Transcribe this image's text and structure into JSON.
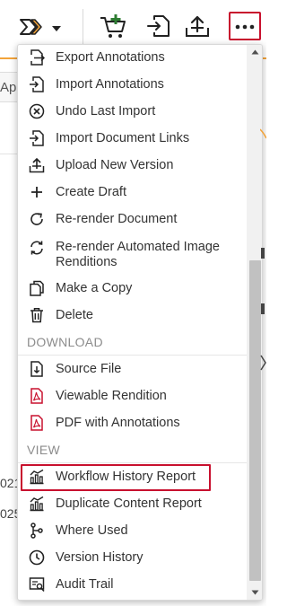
{
  "toolbar": {
    "buttons": [
      {
        "name": "workflow-dropdown",
        "icon": "workflow-chevron-icon"
      },
      {
        "name": "add-to-cart-button",
        "icon": "cart-plus-icon"
      },
      {
        "name": "import-button",
        "icon": "import-icon"
      },
      {
        "name": "upload-button",
        "icon": "upload-icon"
      },
      {
        "name": "more-actions-button",
        "icon": "ellipsis-icon"
      }
    ]
  },
  "background": {
    "tab_fragment": "Ap",
    "row_fragment_1": "021",
    "row_fragment_2": "025"
  },
  "menu": {
    "items_top": [
      {
        "label": "Export Annotations",
        "icon": "export-icon"
      },
      {
        "label": "Import Annotations",
        "icon": "import-icon"
      },
      {
        "label": "Undo Last Import",
        "icon": "circle-x-icon"
      },
      {
        "label": "Import Document Links",
        "icon": "import-icon"
      },
      {
        "label": "Upload New Version",
        "icon": "upload-icon"
      },
      {
        "label": "Create Draft",
        "icon": "plus-icon"
      },
      {
        "label": "Re-render Document",
        "icon": "refresh-icon"
      },
      {
        "label": "Re-render Automated Image Renditions",
        "icon": "sync-icon"
      },
      {
        "label": "Make a Copy",
        "icon": "copy-icon"
      },
      {
        "label": "Delete",
        "icon": "trash-icon"
      }
    ],
    "download_header": "DOWNLOAD",
    "items_download": [
      {
        "label": "Source File",
        "icon": "download-file-icon"
      },
      {
        "label": "Viewable Rendition",
        "icon": "pdf-icon"
      },
      {
        "label": "PDF with Annotations",
        "icon": "pdf-icon"
      }
    ],
    "view_header": "VIEW",
    "items_view": [
      {
        "label": "Workflow History Report",
        "icon": "report-chart-icon",
        "highlighted": true
      },
      {
        "label": "Duplicate Content Report",
        "icon": "report-chart-icon"
      },
      {
        "label": "Where Used",
        "icon": "branch-icon"
      },
      {
        "label": "Version History",
        "icon": "clock-icon"
      },
      {
        "label": "Audit Trail",
        "icon": "audit-icon"
      }
    ]
  },
  "colors": {
    "accent_orange": "#f2a33a",
    "highlight_red": "#c8102e",
    "pdf_red": "#c8102e",
    "icon_dark": "#222222",
    "cart_green": "#2e7d32"
  }
}
